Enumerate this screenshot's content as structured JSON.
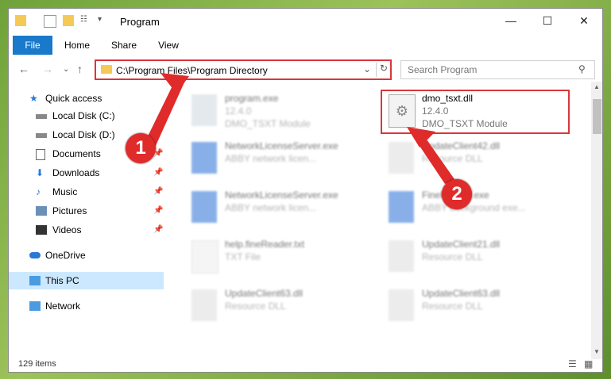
{
  "window": {
    "title": "Program"
  },
  "ribbon": {
    "tabs": [
      "File",
      "Home",
      "Share",
      "View"
    ]
  },
  "address": {
    "path": "C:\\Program Files\\Program Directory"
  },
  "search": {
    "placeholder": "Search Program"
  },
  "nav": {
    "items": [
      {
        "label": "Quick access",
        "icon": "star-icon"
      },
      {
        "label": "Local Disk (C:)",
        "icon": "drive-icon"
      },
      {
        "label": "Local Disk (D:)",
        "icon": "drive-icon"
      },
      {
        "label": "Documents",
        "icon": "documents-icon"
      },
      {
        "label": "Downloads",
        "icon": "download-icon"
      },
      {
        "label": "Music",
        "icon": "music-icon"
      },
      {
        "label": "Pictures",
        "icon": "pictures-icon"
      },
      {
        "label": "Videos",
        "icon": "videos-icon"
      },
      {
        "label": "OneDrive",
        "icon": "cloud-icon"
      },
      {
        "label": "This PC",
        "icon": "pc-icon"
      },
      {
        "label": "Network",
        "icon": "network-icon"
      }
    ]
  },
  "files": [
    {
      "name": "program.exe",
      "line2": "12.4.0",
      "line3": "DMO_TSXT Module",
      "icon": "exe-icon",
      "blurred": true
    },
    {
      "name": "dmo_tsxt.dll",
      "line2": "12.4.0",
      "line3": "DMO_TSXT Module",
      "icon": "dll-icon",
      "blurred": false
    },
    {
      "name": "NetworkLicenseServer.exe",
      "line2": "ABBY network licen...",
      "line3": "",
      "icon": "exe-icon",
      "blurred": true
    },
    {
      "name": "UpdateClient42.dll",
      "line2": "Resource DLL",
      "line3": "",
      "icon": "dll-icon",
      "blurred": true
    },
    {
      "name": "NetworkLicenseServer.exe",
      "line2": "ABBY network licen...",
      "line3": "",
      "icon": "exe-icon",
      "blurred": true
    },
    {
      "name": "FineReader.exe",
      "line2": "ABBY background exe...",
      "line3": "",
      "icon": "exe-icon",
      "blurred": true
    },
    {
      "name": "help.fineReader.txt",
      "line2": "TXT File",
      "line3": "",
      "icon": "txt-icon",
      "blurred": true
    },
    {
      "name": "UpdateClient21.dll",
      "line2": "Resource DLL",
      "line3": "",
      "icon": "dll-icon",
      "blurred": true
    },
    {
      "name": "UpdateClient63.dll",
      "line2": "Resource DLL",
      "line3": "",
      "icon": "dll-icon",
      "blurred": true
    },
    {
      "name": "UpdateClient63.dll",
      "line2": "Resource DLL",
      "line3": "",
      "icon": "dll-icon",
      "blurred": true
    }
  ],
  "status": {
    "count": "129 items"
  },
  "annotations": {
    "step1": "1",
    "step2": "2"
  },
  "colors": {
    "highlight": "#d9363b",
    "file_tab": "#1979ca"
  }
}
